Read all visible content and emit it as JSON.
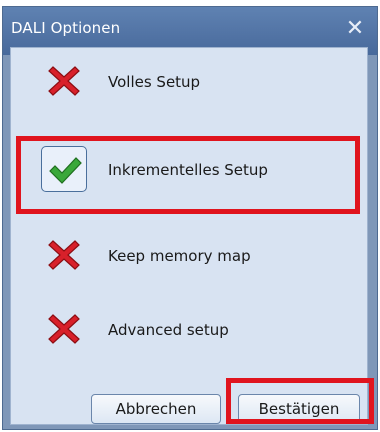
{
  "window": {
    "title": "DALI Optionen"
  },
  "options": [
    {
      "label": "Volles Setup",
      "state": "off",
      "icon": "red-x-icon"
    },
    {
      "label": "Inkrementelles Setup",
      "state": "on",
      "icon": "green-check-icon"
    },
    {
      "label": "Keep memory map",
      "state": "off",
      "icon": "red-x-icon"
    },
    {
      "label": "Advanced setup",
      "state": "off",
      "icon": "red-x-icon"
    }
  ],
  "buttons": {
    "cancel": "Abbrechen",
    "confirm": "Bestätigen"
  },
  "colors": {
    "highlight": "#e0141e",
    "titlebar": "#4f72a5",
    "panel": "#d8e3f2"
  }
}
